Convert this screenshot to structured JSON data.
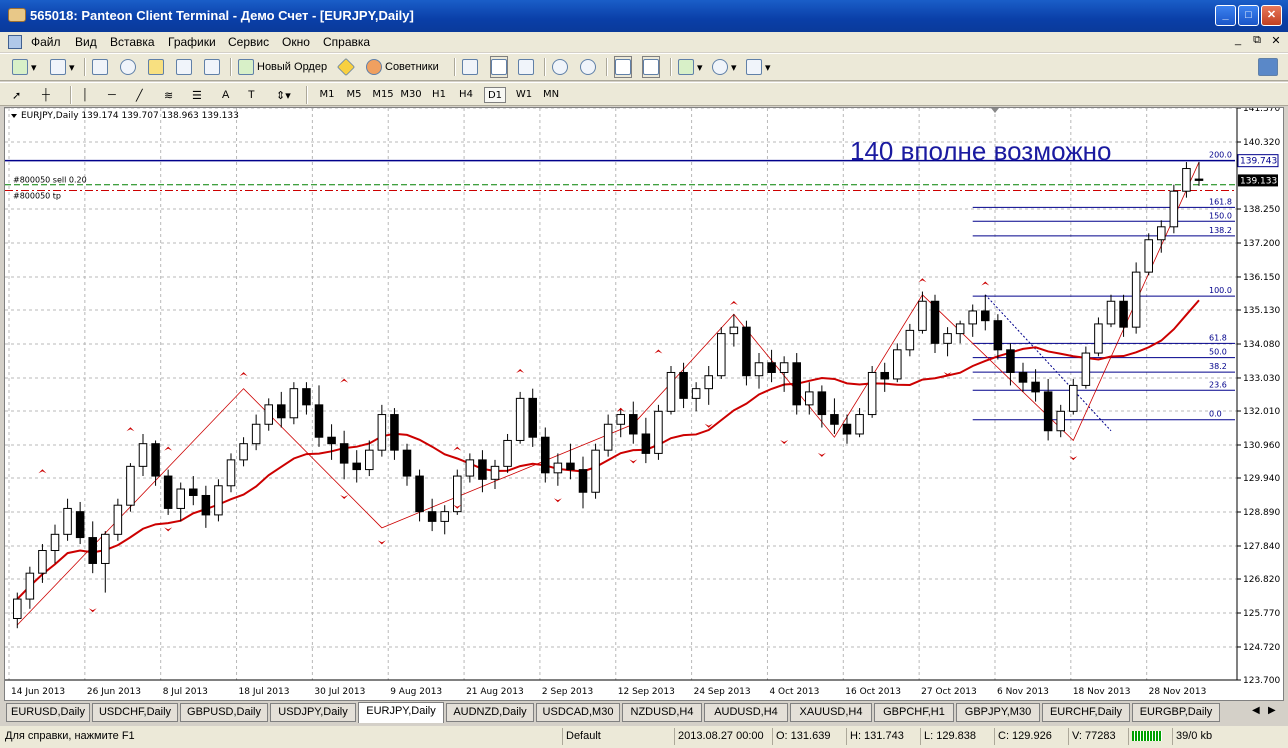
{
  "window": {
    "title": "565018: Panteon Client Terminal - Демо Счет - [EURJPY,Daily]"
  },
  "menu": [
    "Файл",
    "Вид",
    "Вставка",
    "Графики",
    "Сервис",
    "Окно",
    "Справка"
  ],
  "toolbar": {
    "new_order": "Новый Ордер",
    "advisors": "Советники"
  },
  "timeframes": [
    "M1",
    "M5",
    "M15",
    "M30",
    "H1",
    "H4",
    "D1",
    "W1",
    "MN"
  ],
  "active_timeframe": "D1",
  "chart": {
    "header": "EURJPY,Daily  139.174 139.707 138.963 139.133",
    "annotation": "140 вполне возможно",
    "order_sell_label": "#800050 sell 0.20",
    "order_tp_label": "#800050 tp",
    "current_price": "139.133",
    "top_level_price": "139.743"
  },
  "chart_data": {
    "type": "candlestick",
    "symbol": "EURJPY",
    "period": "Daily",
    "ohlc_header": {
      "open": 139.174,
      "high": 139.707,
      "low": 138.963,
      "close": 139.133
    },
    "ylim": [
      123.7,
      141.37
    ],
    "y_ticks": [
      "141.370",
      "140.320",
      "139.743",
      "139.133",
      "138.250",
      "137.200",
      "136.150",
      "135.130",
      "134.080",
      "133.030",
      "132.010",
      "130.960",
      "129.940",
      "128.890",
      "127.840",
      "126.820",
      "125.770",
      "124.720",
      "123.700"
    ],
    "x_ticks": [
      "14 Jun 2013",
      "26 Jun 2013",
      "8 Jul 2013",
      "18 Jul 2013",
      "30 Jul 2013",
      "9 Aug 2013",
      "21 Aug 2013",
      "2 Sep 2013",
      "12 Sep 2013",
      "24 Sep 2013",
      "4 Oct 2013",
      "16 Oct 2013",
      "27 Oct 2013",
      "6 Nov 2013",
      "18 Nov 2013",
      "28 Nov 2013"
    ],
    "fibonacci": {
      "levels": [
        {
          "label": "200.0",
          "price": 139.743
        },
        {
          "label": "161.8",
          "price": 138.3
        },
        {
          "label": "150.0",
          "price": 137.87
        },
        {
          "label": "138.2",
          "price": 137.42
        },
        {
          "label": "100.0",
          "price": 135.56
        },
        {
          "label": "61.8",
          "price": 134.1
        },
        {
          "label": "50.0",
          "price": 133.66
        },
        {
          "label": "38.2",
          "price": 133.21
        },
        {
          "label": "23.6",
          "price": 132.65
        },
        {
          "label": "0.0",
          "price": 131.74
        }
      ]
    },
    "orders": [
      {
        "label": "#800050 sell 0.20",
        "price": 139.0
      },
      {
        "label": "#800050 tp",
        "price": 138.82
      }
    ],
    "candles": [
      [
        125.6,
        126.4,
        125.3,
        126.2
      ],
      [
        126.2,
        127.2,
        125.9,
        127.0
      ],
      [
        127.0,
        127.9,
        126.7,
        127.7
      ],
      [
        127.7,
        128.5,
        127.3,
        128.2
      ],
      [
        128.2,
        129.3,
        128.0,
        129.0
      ],
      [
        128.9,
        129.2,
        127.9,
        128.1
      ],
      [
        128.1,
        128.6,
        127.0,
        127.3
      ],
      [
        127.3,
        128.3,
        126.4,
        128.2
      ],
      [
        128.2,
        129.3,
        128.0,
        129.1
      ],
      [
        129.1,
        130.4,
        128.9,
        130.3
      ],
      [
        130.3,
        131.3,
        130.0,
        131.0
      ],
      [
        131.0,
        131.1,
        129.7,
        130.0
      ],
      [
        130.0,
        130.2,
        128.8,
        129.0
      ],
      [
        129.0,
        129.8,
        128.6,
        129.6
      ],
      [
        129.6,
        130.0,
        129.1,
        129.4
      ],
      [
        129.4,
        129.7,
        128.4,
        128.8
      ],
      [
        128.8,
        129.9,
        128.6,
        129.7
      ],
      [
        129.7,
        130.7,
        129.5,
        130.5
      ],
      [
        130.5,
        131.2,
        130.3,
        131.0
      ],
      [
        131.0,
        131.9,
        130.8,
        131.6
      ],
      [
        131.6,
        132.4,
        131.4,
        132.2
      ],
      [
        132.2,
        132.6,
        131.5,
        131.8
      ],
      [
        131.8,
        132.9,
        131.6,
        132.7
      ],
      [
        132.7,
        132.9,
        131.9,
        132.2
      ],
      [
        132.2,
        132.8,
        130.9,
        131.2
      ],
      [
        131.2,
        131.6,
        130.5,
        131.0
      ],
      [
        131.0,
        131.4,
        129.9,
        130.4
      ],
      [
        130.4,
        130.8,
        129.8,
        130.2
      ],
      [
        130.2,
        131.1,
        130.0,
        130.8
      ],
      [
        130.8,
        132.2,
        130.6,
        131.9
      ],
      [
        131.9,
        132.1,
        130.5,
        130.8
      ],
      [
        130.8,
        131.0,
        129.7,
        130.0
      ],
      [
        130.0,
        130.2,
        128.6,
        128.9
      ],
      [
        128.9,
        129.3,
        128.3,
        128.6
      ],
      [
        128.6,
        129.1,
        128.2,
        128.9
      ],
      [
        128.9,
        130.2,
        128.8,
        130.0
      ],
      [
        130.0,
        130.7,
        129.8,
        130.5
      ],
      [
        130.5,
        130.8,
        129.5,
        129.9
      ],
      [
        129.9,
        130.5,
        129.6,
        130.3
      ],
      [
        130.3,
        131.3,
        130.1,
        131.1
      ],
      [
        131.1,
        132.6,
        131.0,
        132.4
      ],
      [
        132.4,
        132.7,
        130.9,
        131.2
      ],
      [
        131.2,
        131.5,
        129.8,
        130.1
      ],
      [
        130.1,
        130.7,
        129.7,
        130.4
      ],
      [
        130.4,
        131.0,
        129.9,
        130.2
      ],
      [
        130.2,
        130.6,
        129.0,
        129.5
      ],
      [
        129.5,
        131.0,
        129.3,
        130.8
      ],
      [
        130.8,
        131.9,
        130.6,
        131.6
      ],
      [
        131.6,
        132.1,
        131.2,
        131.9
      ],
      [
        131.9,
        132.3,
        131.0,
        131.3
      ],
      [
        131.3,
        131.8,
        130.4,
        130.7
      ],
      [
        130.7,
        132.2,
        130.5,
        132.0
      ],
      [
        132.0,
        133.4,
        131.9,
        133.2
      ],
      [
        133.2,
        133.5,
        132.1,
        132.4
      ],
      [
        132.4,
        132.9,
        132.0,
        132.7
      ],
      [
        132.7,
        133.4,
        132.2,
        133.1
      ],
      [
        133.1,
        134.6,
        133.0,
        134.4
      ],
      [
        134.4,
        135.0,
        134.0,
        134.6
      ],
      [
        134.6,
        134.8,
        132.8,
        133.1
      ],
      [
        133.1,
        133.8,
        132.7,
        133.5
      ],
      [
        133.5,
        133.9,
        132.9,
        133.2
      ],
      [
        133.2,
        133.7,
        132.6,
        133.5
      ],
      [
        133.5,
        133.8,
        131.9,
        132.2
      ],
      [
        132.2,
        132.9,
        131.9,
        132.6
      ],
      [
        132.6,
        132.8,
        131.5,
        131.9
      ],
      [
        131.9,
        132.4,
        131.3,
        131.6
      ],
      [
        131.6,
        131.9,
        131.0,
        131.3
      ],
      [
        131.3,
        132.1,
        131.2,
        131.9
      ],
      [
        131.9,
        133.4,
        131.8,
        133.2
      ],
      [
        133.2,
        133.5,
        132.6,
        133.0
      ],
      [
        133.0,
        134.1,
        132.9,
        133.9
      ],
      [
        133.9,
        134.7,
        133.7,
        134.5
      ],
      [
        134.5,
        135.7,
        134.4,
        135.4
      ],
      [
        135.4,
        135.6,
        133.8,
        134.1
      ],
      [
        134.1,
        134.6,
        133.7,
        134.4
      ],
      [
        134.4,
        134.8,
        134.1,
        134.7
      ],
      [
        134.7,
        135.3,
        134.3,
        135.1
      ],
      [
        135.1,
        135.6,
        134.5,
        134.8
      ],
      [
        134.8,
        135.0,
        133.6,
        133.9
      ],
      [
        133.9,
        134.1,
        132.8,
        133.2
      ],
      [
        133.2,
        133.5,
        132.6,
        132.9
      ],
      [
        132.9,
        133.3,
        132.3,
        132.6
      ],
      [
        132.6,
        133.0,
        131.1,
        131.4
      ],
      [
        131.4,
        132.2,
        131.2,
        132.0
      ],
      [
        132.0,
        133.0,
        131.9,
        132.8
      ],
      [
        132.8,
        134.0,
        132.7,
        133.8
      ],
      [
        133.8,
        134.9,
        133.7,
        134.7
      ],
      [
        134.7,
        135.6,
        134.6,
        135.4
      ],
      [
        135.4,
        135.6,
        134.3,
        134.6
      ],
      [
        134.6,
        136.6,
        134.4,
        136.3
      ],
      [
        136.3,
        137.5,
        136.2,
        137.3
      ],
      [
        137.3,
        137.9,
        136.9,
        137.7
      ],
      [
        137.7,
        139.0,
        137.5,
        138.8
      ],
      [
        138.8,
        139.7,
        138.6,
        139.5
      ],
      [
        139.174,
        139.707,
        138.963,
        139.133
      ]
    ],
    "moving_average": {
      "color": "#cc0000"
    }
  },
  "tabs": [
    "EURUSD,Daily",
    "USDCHF,Daily",
    "GBPUSD,Daily",
    "USDJPY,Daily",
    "EURJPY,Daily",
    "AUDNZD,Daily",
    "USDCAD,M30",
    "NZDUSD,H4",
    "AUDUSD,H4",
    "XAUUSD,H4",
    "GBPCHF,H1",
    "GBPJPY,M30",
    "EURCHF,Daily",
    "EURGBP,Daily"
  ],
  "active_tab": "EURJPY,Daily",
  "status": {
    "help": "Для справки, нажмите F1",
    "profile": "Default",
    "datetime": "2013.08.27 00:00",
    "open": "O: 131.639",
    "high": "H: 131.743",
    "low": "L: 129.838",
    "close": "C: 129.926",
    "volume": "V: 77283",
    "traffic": "39/0 kb"
  },
  "colors": {
    "bull": "#ffffff",
    "bear": "#000000",
    "fib": "#00008b",
    "ma": "#cc0000",
    "fractal": "#cc0000",
    "sell": "#cc0000",
    "tp": "#008000",
    "annotation": "#1a1aa0"
  }
}
